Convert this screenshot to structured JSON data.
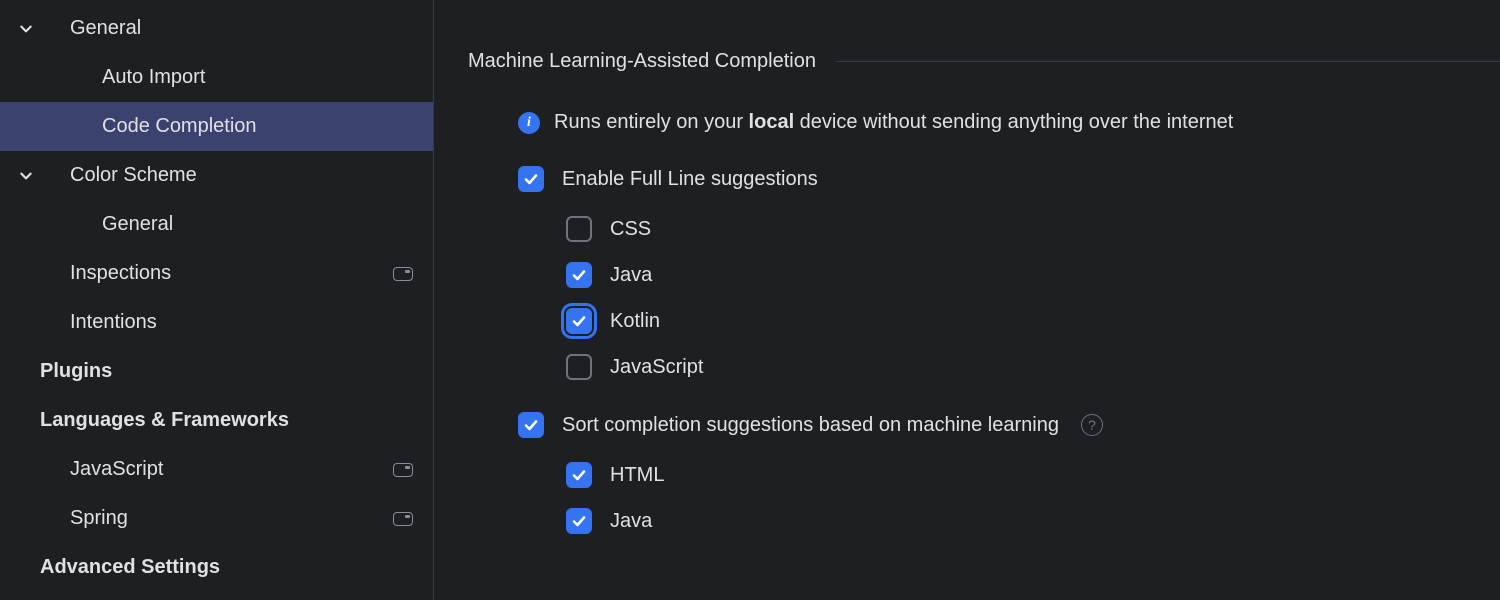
{
  "sidebar": {
    "items": [
      {
        "label": "General",
        "level": 1,
        "expandable": true,
        "top": false,
        "selected": false,
        "badge": false
      },
      {
        "label": "Auto Import",
        "level": 2,
        "expandable": false,
        "top": false,
        "selected": false,
        "badge": false
      },
      {
        "label": "Code Completion",
        "level": 2,
        "expandable": false,
        "top": false,
        "selected": true,
        "badge": false
      },
      {
        "label": "Color Scheme",
        "level": 1,
        "expandable": true,
        "top": false,
        "selected": false,
        "badge": false
      },
      {
        "label": "General",
        "level": 2,
        "expandable": false,
        "top": false,
        "selected": false,
        "badge": false
      },
      {
        "label": "Inspections",
        "level": 1,
        "expandable": false,
        "top": false,
        "selected": false,
        "badge": true
      },
      {
        "label": "Intentions",
        "level": 1,
        "expandable": false,
        "top": false,
        "selected": false,
        "badge": false
      },
      {
        "label": "Plugins",
        "level": 0,
        "expandable": false,
        "top": true,
        "selected": false,
        "badge": false
      },
      {
        "label": "Languages & Frameworks",
        "level": 0,
        "expandable": false,
        "top": true,
        "selected": false,
        "badge": false
      },
      {
        "label": "JavaScript",
        "level": 1,
        "expandable": false,
        "top": false,
        "selected": false,
        "badge": true
      },
      {
        "label": "Spring",
        "level": 1,
        "expandable": false,
        "top": false,
        "selected": false,
        "badge": true
      },
      {
        "label": "Advanced Settings",
        "level": 0,
        "expandable": false,
        "top": true,
        "selected": false,
        "badge": false
      }
    ]
  },
  "main": {
    "section_title": "Machine Learning-Assisted Completion",
    "info_prefix": "Runs entirely on your ",
    "info_bold": "local",
    "info_suffix": " device without sending anything over the internet",
    "enable_full_line": {
      "label": "Enable Full Line suggestions",
      "checked": true,
      "focused": false
    },
    "langs_full_line": [
      {
        "label": "CSS",
        "checked": false,
        "focused": false
      },
      {
        "label": "Java",
        "checked": true,
        "focused": false
      },
      {
        "label": "Kotlin",
        "checked": true,
        "focused": true
      },
      {
        "label": "JavaScript",
        "checked": false,
        "focused": false
      }
    ],
    "sort_ml": {
      "label": "Sort completion suggestions based on machine learning",
      "checked": true,
      "focused": false,
      "help": true
    },
    "langs_sort": [
      {
        "label": "HTML",
        "checked": true,
        "focused": false
      },
      {
        "label": "Java",
        "checked": true,
        "focused": false
      }
    ]
  }
}
